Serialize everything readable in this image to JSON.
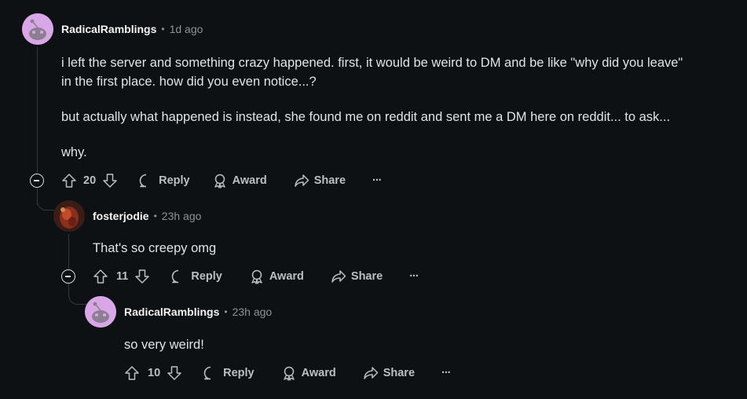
{
  "comments": [
    {
      "author": "RadicalRamblings",
      "time": "1d ago",
      "body": [
        "i left the server and something crazy happened. first, it would be weird to DM and be like \"why did you leave\"",
        "in the first place. how did you even notice...?",
        "but actually what happened is instead, she found me on reddit and sent me a DM here on reddit... to ask...",
        "why."
      ],
      "votes": "20"
    },
    {
      "author": "fosterjodie",
      "time": "23h ago",
      "body": [
        "That's so creepy omg"
      ],
      "votes": "11"
    },
    {
      "author": "RadicalRamblings",
      "time": "23h ago",
      "body": [
        "so very weird!"
      ],
      "votes": "10"
    }
  ],
  "actions": {
    "reply": "Reply",
    "award": "Award",
    "share": "Share",
    "more": "···"
  },
  "colors": {
    "background": "#0e1113",
    "avatar_pink": "#d9a7e8",
    "text": "#e1e4e6",
    "muted": "#8b9396"
  }
}
